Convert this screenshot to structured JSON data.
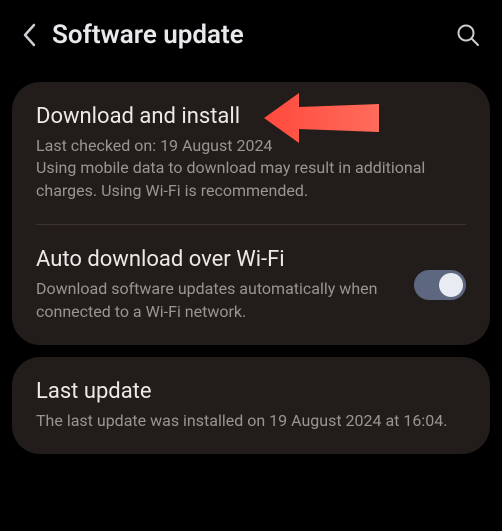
{
  "header": {
    "title": "Software update"
  },
  "items": {
    "download_install": {
      "title": "Download and install",
      "subtitle": "Last checked on: 19 August 2024\nUsing mobile data to download may result in additional charges. Using Wi-Fi is recommended."
    },
    "auto_download": {
      "title": "Auto download over Wi-Fi",
      "subtitle": "Download software updates automatically when connected to a Wi-Fi network."
    },
    "last_update": {
      "title": "Last update",
      "subtitle": "The last update was installed on 19 August 2024 at 16:04."
    }
  }
}
